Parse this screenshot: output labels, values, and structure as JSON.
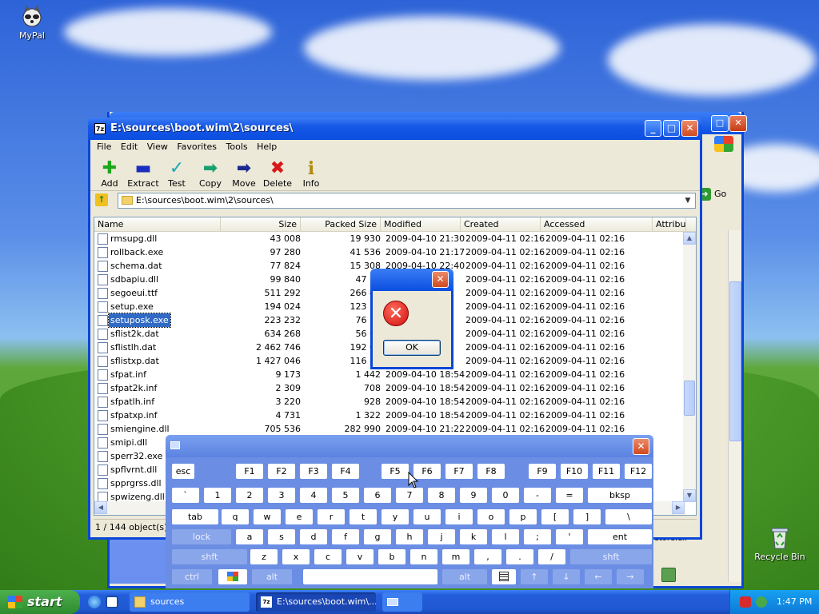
{
  "desktop": {
    "icons": [
      {
        "label": "MyPal"
      },
      {
        "label": "Recycle Bin"
      }
    ]
  },
  "bg_window": {
    "go_label": "Go",
    "file_hint": "rstore.dll"
  },
  "window": {
    "title": "E:\\sources\\boot.wim\\2\\sources\\",
    "app_icon_text": "7z",
    "controls": {
      "minimize": "_",
      "maximize": "□",
      "close": "✕"
    },
    "menu": [
      "File",
      "Edit",
      "View",
      "Favorites",
      "Tools",
      "Help"
    ],
    "toolbar": [
      {
        "label": "Add",
        "icon": "plus-icon",
        "glyph": "✚",
        "color": "#1aa81a"
      },
      {
        "label": "Extract",
        "icon": "minus-icon",
        "glyph": "▬",
        "color": "#1a2fc0"
      },
      {
        "label": "Test",
        "icon": "check-icon",
        "glyph": "✓",
        "color": "#18a8b0"
      },
      {
        "label": "Copy",
        "icon": "copy-arrow-icon",
        "glyph": "➡",
        "color": "#18a070"
      },
      {
        "label": "Move",
        "icon": "move-arrow-icon",
        "glyph": "➡",
        "color": "#1a2a90"
      },
      {
        "label": "Delete",
        "icon": "delete-x-icon",
        "glyph": "✖",
        "color": "#d81818"
      },
      {
        "label": "Info",
        "icon": "info-icon",
        "glyph": "i",
        "color": "#b08a10"
      }
    ],
    "address": "E:\\sources\\boot.wim\\2\\sources\\",
    "columns": [
      "Name",
      "Size",
      "Packed Size",
      "Modified",
      "Created",
      "Accessed",
      "Attribu"
    ],
    "rows": [
      {
        "name": "rmsupg.dll",
        "size": "43 008",
        "packed": "19 930",
        "modified": "2009-04-10 21:30",
        "created": "2009-04-11 02:16",
        "accessed": "2009-04-11 02:16"
      },
      {
        "name": "rollback.exe",
        "size": "97 280",
        "packed": "41 536",
        "modified": "2009-04-10 21:17",
        "created": "2009-04-11 02:16",
        "accessed": "2009-04-11 02:16"
      },
      {
        "name": "schema.dat",
        "size": "77 824",
        "packed": "15 308",
        "modified": "2009-04-10 22:40",
        "created": "2009-04-11 02:16",
        "accessed": "2009-04-11 02:16"
      },
      {
        "name": "sdbapiu.dll",
        "size": "99 840",
        "packed": "47 16",
        "modified": "",
        "created": "2009-04-11 02:16",
        "accessed": "2009-04-11 02:16"
      },
      {
        "name": "segoeui.ttf",
        "size": "511 292",
        "packed": "266 44",
        "modified": "",
        "created": "2009-04-11 02:16",
        "accessed": "2009-04-11 02:16"
      },
      {
        "name": "setup.exe",
        "size": "194 024",
        "packed": "123 13",
        "modified": "",
        "created": "2009-04-11 02:16",
        "accessed": "2009-04-11 02:16"
      },
      {
        "name": "setuposk.exe",
        "size": "223 232",
        "packed": "76 12",
        "modified": "",
        "created": "2009-04-11 02:16",
        "accessed": "2009-04-11 02:16"
      },
      {
        "name": "sflist2k.dat",
        "size": "634 268",
        "packed": "56 65",
        "modified": "",
        "created": "2009-04-11 02:16",
        "accessed": "2009-04-11 02:16"
      },
      {
        "name": "sflistlh.dat",
        "size": "2 462 746",
        "packed": "192 03",
        "modified": "",
        "created": "2009-04-11 02:16",
        "accessed": "2009-04-11 02:16"
      },
      {
        "name": "sflistxp.dat",
        "size": "1 427 046",
        "packed": "116 87",
        "modified": "",
        "created": "2009-04-11 02:16",
        "accessed": "2009-04-11 02:16"
      },
      {
        "name": "sfpat.inf",
        "size": "9 173",
        "packed": "1 442",
        "modified": "2009-04-10 18:54",
        "created": "2009-04-11 02:16",
        "accessed": "2009-04-11 02:16"
      },
      {
        "name": "sfpat2k.inf",
        "size": "2 309",
        "packed": "708",
        "modified": "2009-04-10 18:54",
        "created": "2009-04-11 02:16",
        "accessed": "2009-04-11 02:16"
      },
      {
        "name": "sfpatlh.inf",
        "size": "3 220",
        "packed": "928",
        "modified": "2009-04-10 18:54",
        "created": "2009-04-11 02:16",
        "accessed": "2009-04-11 02:16"
      },
      {
        "name": "sfpatxp.inf",
        "size": "4 731",
        "packed": "1 322",
        "modified": "2009-04-10 18:54",
        "created": "2009-04-11 02:16",
        "accessed": "2009-04-11 02:16"
      },
      {
        "name": "smiengine.dll",
        "size": "705 536",
        "packed": "282 990",
        "modified": "2009-04-10 21:22",
        "created": "2009-04-11 02:16",
        "accessed": "2009-04-11 02:16"
      },
      {
        "name": "smipi.dll",
        "size": "",
        "packed": "",
        "modified": "",
        "created": "",
        "accessed": ""
      },
      {
        "name": "sperr32.exe",
        "size": "",
        "packed": "",
        "modified": "",
        "created": "",
        "accessed": ""
      },
      {
        "name": "spflvrnt.dll",
        "size": "",
        "packed": "",
        "modified": "",
        "created": "",
        "accessed": ""
      },
      {
        "name": "spprgrss.dll",
        "size": "",
        "packed": "",
        "modified": "",
        "created": "",
        "accessed": ""
      },
      {
        "name": "spwizeng.dll",
        "size": "",
        "packed": "",
        "modified": "",
        "created": "",
        "accessed": ""
      }
    ],
    "selected_row": "setuposk.exe",
    "status": "1 / 144 object(s) se"
  },
  "dialog": {
    "ok_label": "OK",
    "close_glyph": "✕",
    "error_glyph": "✕"
  },
  "osk": {
    "close_glyph": "✕",
    "row1": [
      "esc",
      "F1",
      "F2",
      "F3",
      "F4",
      "F5",
      "F6",
      "F7",
      "F8",
      "F9",
      "F10",
      "F11",
      "F12"
    ],
    "row2": [
      "`",
      "1",
      "2",
      "3",
      "4",
      "5",
      "6",
      "7",
      "8",
      "9",
      "0",
      "-",
      "=",
      "bksp"
    ],
    "row3": [
      "tab",
      "q",
      "w",
      "e",
      "r",
      "t",
      "y",
      "u",
      "i",
      "o",
      "p",
      "[",
      "]",
      "\\"
    ],
    "row4": [
      "lock",
      "a",
      "s",
      "d",
      "f",
      "g",
      "h",
      "j",
      "k",
      "l",
      ";",
      "'",
      "ent"
    ],
    "row5": [
      "shft",
      "z",
      "x",
      "c",
      "v",
      "b",
      "n",
      "m",
      ",",
      ".",
      "/",
      "shft"
    ],
    "row6": [
      "ctrl",
      "win",
      "alt",
      "",
      "alt",
      "menu",
      "↑",
      "↓",
      "←",
      "→"
    ]
  },
  "taskbar": {
    "start_label": "start",
    "tasks": [
      "sources",
      "E:\\sources\\boot.wim\\..."
    ],
    "clock": "1:47 PM"
  }
}
